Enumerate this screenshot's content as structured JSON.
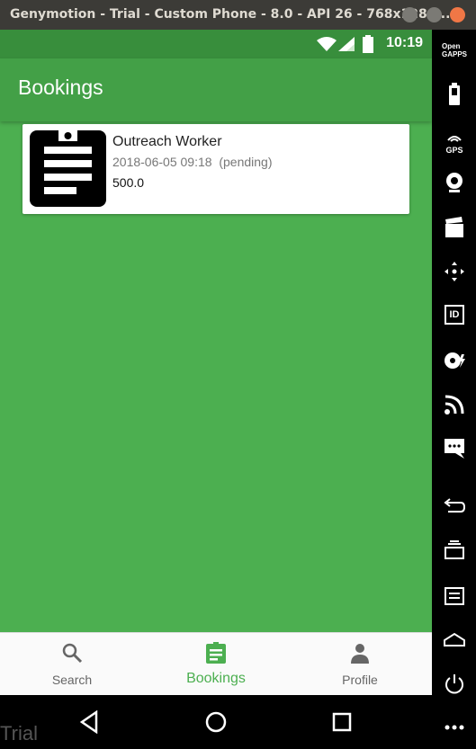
{
  "window": {
    "title": "Genymotion - Trial - Custom Phone - 8.0 - API 26 - 768x1280..."
  },
  "status_bar": {
    "time": "10:19"
  },
  "app_bar": {
    "title": "Bookings"
  },
  "bookings": [
    {
      "name": "Outreach Worker",
      "date": "2018-06-05 09:18",
      "status": "(pending)",
      "price": "500.0",
      "icon": "clipboard-icon"
    }
  ],
  "bottom_nav": {
    "items": [
      {
        "label": "Search",
        "icon": "search-icon",
        "active": false
      },
      {
        "label": "Bookings",
        "icon": "clipboard-icon",
        "active": true
      },
      {
        "label": "Profile",
        "icon": "person-icon",
        "active": false
      }
    ]
  },
  "watermark": "Trial",
  "sidebar": {
    "top_label": "Open GAPPS",
    "gps_label": "GPS",
    "id_label": "ID",
    "items": [
      "opengapps-icon",
      "battery-icon",
      "gps-icon",
      "webcam-icon",
      "media-icon",
      "dpad-icon",
      "identifier-icon",
      "disk-icon",
      "network-icon",
      "sms-icon",
      "back-icon",
      "recent-apps-icon",
      "menu-icon",
      "home-icon",
      "power-icon",
      "more-icon"
    ]
  },
  "colors": {
    "primary": "#4caf50",
    "primary_dark": "#388e3c",
    "app_bar": "#43a047",
    "accent_active": "#4caf50"
  }
}
